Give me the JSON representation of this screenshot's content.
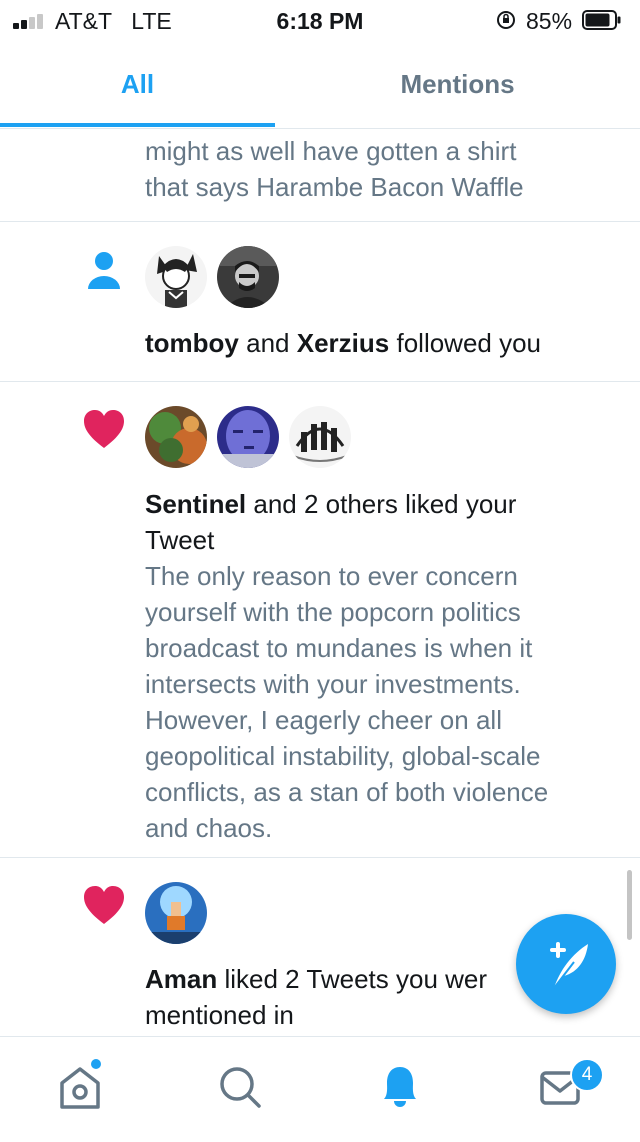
{
  "status_bar": {
    "carrier": "AT&T",
    "network": "LTE",
    "time": "6:18 PM",
    "battery": "85%"
  },
  "tabs": {
    "all": "All",
    "mentions": "Mentions",
    "active": "All"
  },
  "feed": {
    "tweet_fragment": {
      "line1": "might as well have gotten a shirt",
      "line2": "that says Harambe Bacon Waffle"
    },
    "follow": {
      "user1": "tomboy",
      "joiner": "and",
      "user2": "Xerzius",
      "action": "followed you"
    },
    "like_group": {
      "user": "Sentinel",
      "action_line1": "and 2 others liked your",
      "action_line2": "Tweet",
      "quote_lines": [
        "The only reason to ever concern",
        "yourself with the popcorn politics",
        "broadcast to mundanes is when it",
        "intersects with your investments.",
        "However, I eagerly cheer on all",
        "geopolitical instability, global-scale",
        "conflicts, as a stan of both violence",
        "and chaos."
      ]
    },
    "like_mention": {
      "user": "Aman",
      "action_line1": "liked 2 Tweets you wer",
      "action_line2": "mentioned in"
    }
  },
  "nav": {
    "messages_badge": "4"
  },
  "colors": {
    "accent": "#1da1f2",
    "like": "#e0245e",
    "secondary_text": "#657786",
    "divider": "#e1e8ed"
  },
  "icons": [
    "person-icon",
    "heart-icon",
    "compose-tweet-icon",
    "home-icon",
    "search-icon",
    "notifications-bell-icon",
    "messages-icon"
  ]
}
